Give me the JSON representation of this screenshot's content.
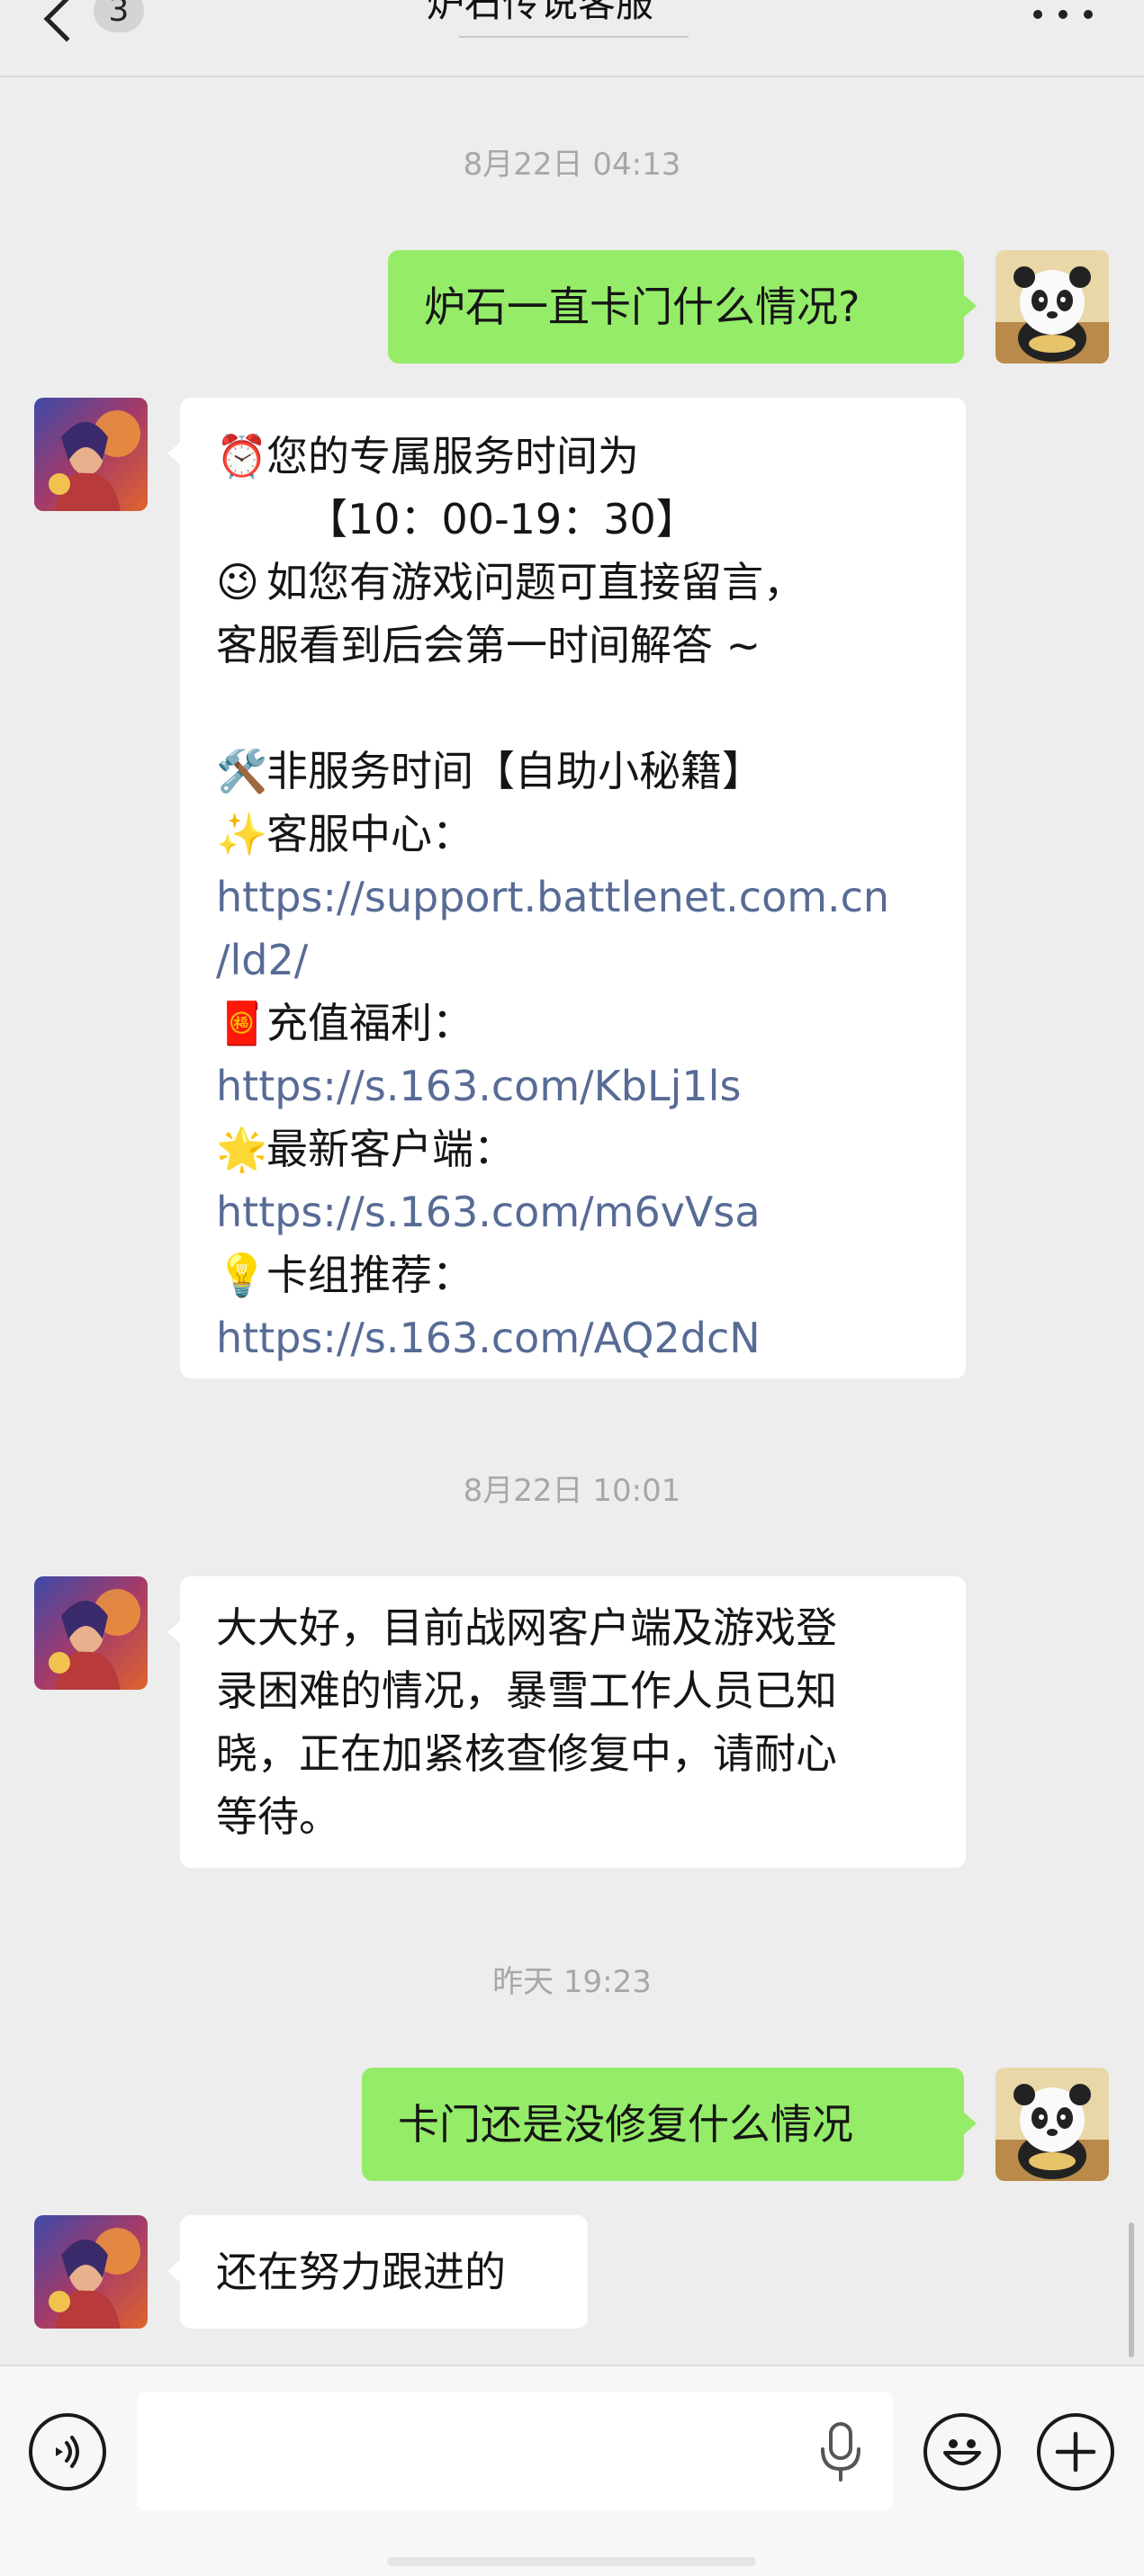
{
  "header": {
    "unread_count": "3",
    "title": "炉石传说客服"
  },
  "timestamps": [
    "8月22日 04:13",
    "8月22日 10:01",
    "昨天 19:23"
  ],
  "messages": {
    "m1": {
      "text": "炉石一直卡门什么情况?"
    },
    "m2": {
      "line1_emoji": "⏰",
      "line1": "您的专属服务时间为",
      "line2": "【10：00-19：30】",
      "line3_emoji": "😉",
      "line3": "如您有游戏问题可直接留言，",
      "line4": "客服看到后会第一时间解答 ~",
      "line5_emoji": "🛠️",
      "line5": "非服务时间【自助小秘籍】",
      "line6_emoji": "✨",
      "line6": "客服中心：",
      "link1_a": "https://support.battlenet.com.cn",
      "link1_b": "/ld2/",
      "line7_emoji": "🧧",
      "line7": "充值福利：",
      "link2": "https://s.163.com/KbLj1ls",
      "line8_emoji": "🌟",
      "line8": "最新客户端：",
      "link3": "https://s.163.com/m6vVsa",
      "line9_emoji": "💡",
      "line9": "卡组推荐：",
      "link4": "https://s.163.com/AQ2dcN"
    },
    "m3": {
      "line1": "大大好，目前战网客户端及游戏登",
      "line2": "录困难的情况，暴雪工作人员已知",
      "line3": "晓，正在加紧核查修复中，请耐心",
      "line4": "等待。"
    },
    "m4": {
      "text": "卡门还是没修复什么情况"
    },
    "m5": {
      "text": "还在努力跟进的"
    }
  },
  "input": {
    "placeholder": ""
  },
  "colors": {
    "background": "#ededed",
    "outgoing_bubble": "#95ec69",
    "incoming_bubble": "#ffffff",
    "link": "#576b95",
    "timestamp": "#a7a7a7"
  },
  "icons": [
    "back-chevron-icon",
    "more-icon",
    "voice-icon",
    "mic-icon",
    "emoji-icon",
    "plus-icon",
    "panda-avatar",
    "hero-avatar"
  ]
}
